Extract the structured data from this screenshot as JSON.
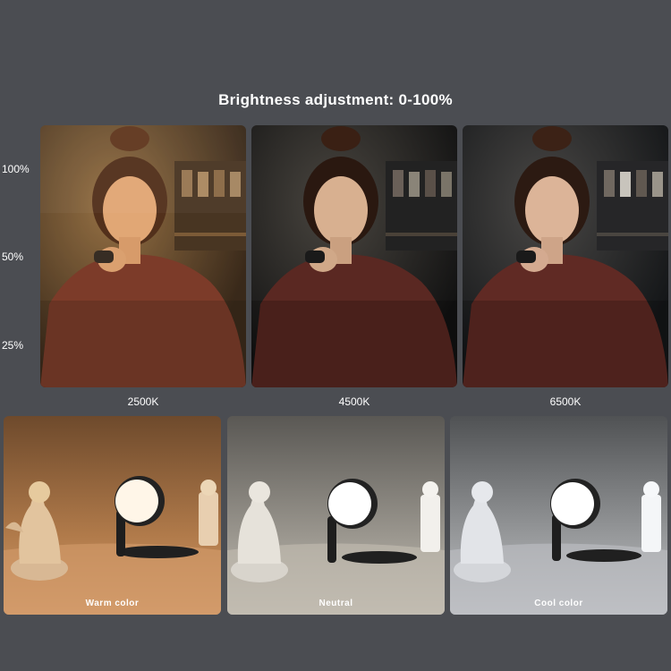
{
  "title": "Brightness adjustment: 0-100%",
  "brightness_levels": [
    "100%",
    "50%",
    "25%"
  ],
  "color_temperatures": [
    "2500K",
    "4500K",
    "6500K"
  ],
  "lamp_modes": [
    "Warm color",
    "Neutral",
    "Cool color"
  ],
  "colors": {
    "background": "#4b4d52",
    "warm_tint": "#e8a060",
    "neutral_tint": "#d8d2c8",
    "cool_tint": "#d0d8e4"
  }
}
